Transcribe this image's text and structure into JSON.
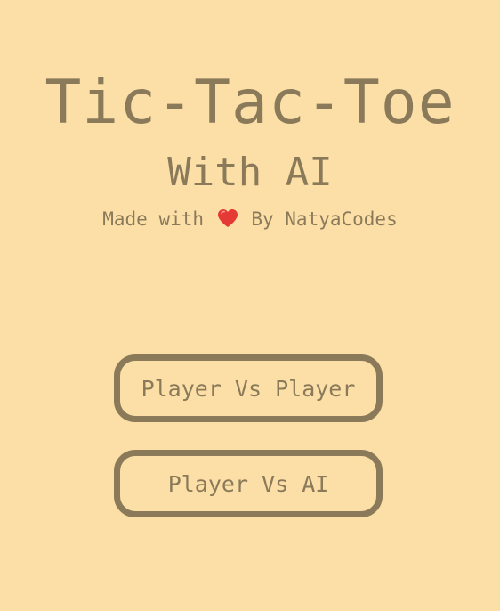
{
  "header": {
    "title": "Tic-Tac-Toe",
    "subtitle": "With AI",
    "credit_prefix": "Made with",
    "credit_icon": "heart-icon",
    "credit_suffix": "By NatyaCodes"
  },
  "menu": {
    "buttons": [
      {
        "label": "Player Vs Player"
      },
      {
        "label": "Player Vs AI"
      }
    ]
  },
  "colors": {
    "background": "#fcdfa7",
    "text": "#8a7a5a",
    "heart": "#e53935"
  }
}
